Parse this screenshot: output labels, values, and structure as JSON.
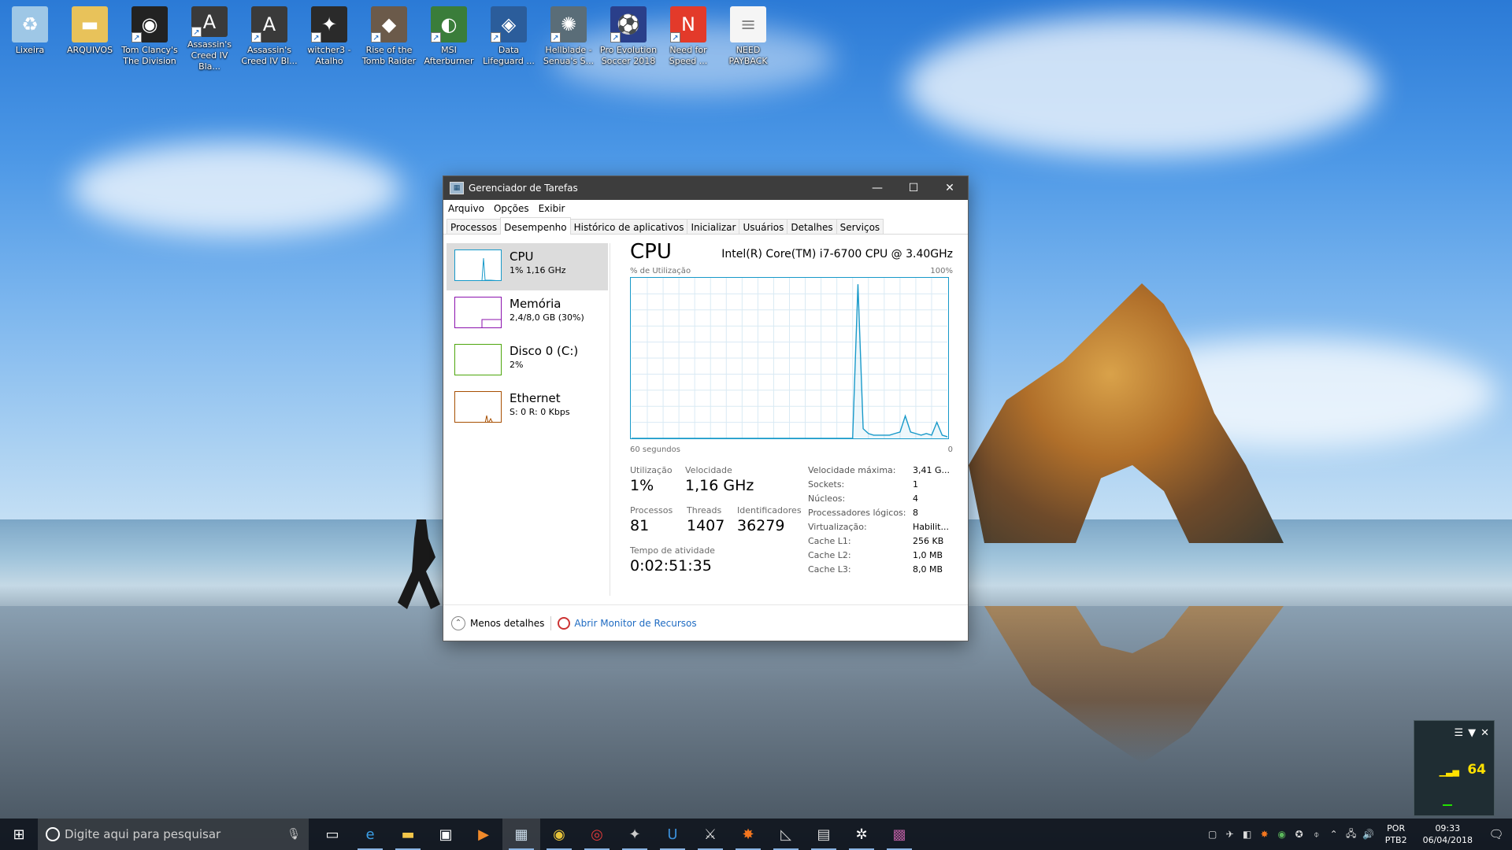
{
  "desktop": {
    "icons": [
      {
        "label": "Lixeira",
        "icon": "recycle-bin-icon",
        "glyph": "♻",
        "bg": "#9ec7e6",
        "shortcut": false
      },
      {
        "label": "ARQUIVOS",
        "icon": "folder-icon",
        "glyph": "▬",
        "bg": "#e8c25a",
        "shortcut": false
      },
      {
        "label": "Tom Clancy's The Division",
        "icon": "division-game-icon",
        "glyph": "◉",
        "bg": "#222",
        "shortcut": true
      },
      {
        "label": "Assassin's Creed IV Bla...",
        "icon": "assassins-creed-icon",
        "glyph": "A",
        "bg": "#3a3a3a",
        "shortcut": true
      },
      {
        "label": "Assassin's Creed IV Bl...",
        "icon": "assassins-creed-icon",
        "glyph": "A",
        "bg": "#3a3a3a",
        "shortcut": true
      },
      {
        "label": "witcher3 - Atalho",
        "icon": "witcher-icon",
        "glyph": "✦",
        "bg": "#2a2a2a",
        "shortcut": true
      },
      {
        "label": "Rise of the Tomb Raider",
        "icon": "tomb-raider-icon",
        "glyph": "◆",
        "bg": "#6b5a4a",
        "shortcut": true
      },
      {
        "label": "MSI Afterburner",
        "icon": "msi-afterburner-icon",
        "glyph": "◐",
        "bg": "#3a7d3a",
        "shortcut": true
      },
      {
        "label": "Data Lifeguard ...",
        "icon": "data-lifeguard-icon",
        "glyph": "◈",
        "bg": "#2b5d9b",
        "shortcut": true
      },
      {
        "label": "Hellblade - Senua's S...",
        "icon": "hellblade-icon",
        "glyph": "✺",
        "bg": "#5a6d78",
        "shortcut": true
      },
      {
        "label": "Pro Evolution Soccer 2018",
        "icon": "pes-icon",
        "glyph": "⚽",
        "bg": "#2a3f8a",
        "shortcut": true
      },
      {
        "label": "Need for Speed ...",
        "icon": "nfs-icon",
        "glyph": "N",
        "bg": "#e33a2a",
        "shortcut": true
      },
      {
        "label": "NEED PAYBACK",
        "icon": "text-file-icon",
        "glyph": "≡",
        "bg": "#f5f5f5",
        "shortcut": false
      }
    ]
  },
  "taskmgr": {
    "title": "Gerenciador de Tarefas",
    "menu": [
      "Arquivo",
      "Opções",
      "Exibir"
    ],
    "tabs": [
      "Processos",
      "Desempenho",
      "Histórico de aplicativos",
      "Inicializar",
      "Usuários",
      "Detalhes",
      "Serviços"
    ],
    "active_tab": "Desempenho",
    "sidebar": [
      {
        "name": "CPU",
        "value": "1% 1,16 GHz",
        "color": "#1799c9",
        "selected": true
      },
      {
        "name": "Memória",
        "value": "2,4/8,0 GB (30%)",
        "color": "#8b12ae",
        "selected": false
      },
      {
        "name": "Disco 0 (C:)",
        "value": "2%",
        "color": "#4da60c",
        "selected": false
      },
      {
        "name": "Ethernet",
        "value": "S: 0 R: 0 Kbps",
        "color": "#a74f01",
        "selected": false
      }
    ],
    "main": {
      "heading": "CPU",
      "model": "Intel(R) Core(TM) i7-6700 CPU @ 3.40GHz",
      "graph_label_left": "% de Utilização",
      "graph_label_right": "100%",
      "axis_left": "60 segundos",
      "axis_right": "0",
      "stats": {
        "utilizacao_label": "Utilização",
        "utilizacao": "1%",
        "velocidade_label": "Velocidade",
        "velocidade": "1,16 GHz",
        "processos_label": "Processos",
        "processos": "81",
        "threads_label": "Threads",
        "threads": "1407",
        "identificadores_label": "Identificadores",
        "identificadores": "36279",
        "tempo_label": "Tempo de atividade",
        "tempo": "0:02:51:35"
      },
      "specs": [
        {
          "k": "Velocidade máxima:",
          "v": "3,41 G..."
        },
        {
          "k": "Sockets:",
          "v": "1"
        },
        {
          "k": "Núcleos:",
          "v": "4"
        },
        {
          "k": "Processadores lógicos:",
          "v": "8"
        },
        {
          "k": "Virtualização:",
          "v": "Habilit..."
        },
        {
          "k": "Cache L1:",
          "v": "256 KB"
        },
        {
          "k": "Cache L2:",
          "v": "1,0 MB"
        },
        {
          "k": "Cache L3:",
          "v": "8,0 MB"
        }
      ]
    },
    "footer": {
      "less": "Menos detalhes",
      "resmon": "Abrir Monitor de Recursos"
    }
  },
  "chart_data": {
    "type": "line",
    "title": "CPU",
    "xlabel": "",
    "ylabel": "% de Utilização",
    "x": [
      60,
      57,
      54,
      51,
      48,
      45,
      42,
      39,
      36,
      33,
      30,
      27,
      24,
      21,
      18,
      17,
      16,
      15,
      14,
      13,
      12,
      11,
      10,
      9,
      8,
      7,
      6,
      5,
      4,
      3,
      2,
      1,
      0
    ],
    "values": [
      0,
      0,
      0,
      0,
      0,
      0,
      0,
      0,
      0,
      0,
      0,
      0,
      0,
      0,
      0,
      96,
      6,
      3,
      2,
      2,
      2,
      2,
      3,
      4,
      14,
      4,
      3,
      2,
      3,
      2,
      10,
      2,
      1
    ],
    "xlim": [
      60,
      0
    ],
    "ylim": [
      0,
      100
    ],
    "grid": true,
    "line_color": "#1799c9"
  },
  "widget": {
    "value": "64"
  },
  "taskbar": {
    "search_placeholder": "Digite aqui para pesquisar",
    "apps": [
      {
        "icon": "task-view-icon",
        "glyph": "▭",
        "color": "#fff"
      },
      {
        "icon": "edge-icon",
        "glyph": "e",
        "color": "#3ba0e8"
      },
      {
        "icon": "file-explorer-icon",
        "glyph": "▬",
        "color": "#f3c64a"
      },
      {
        "icon": "store-icon",
        "glyph": "▣",
        "color": "#fff"
      },
      {
        "icon": "media-player-icon",
        "glyph": "▶",
        "color": "#f18a2a"
      },
      {
        "icon": "task-manager-icon",
        "glyph": "▦",
        "color": "#cfe0ee"
      },
      {
        "icon": "chrome-icon",
        "glyph": "◉",
        "color": "#e7c33a"
      },
      {
        "icon": "game-launcher-icon",
        "glyph": "◎",
        "color": "#e03a3a"
      },
      {
        "icon": "witcher-icon",
        "glyph": "✦",
        "color": "#ccc"
      },
      {
        "icon": "uplay-icon",
        "glyph": "U",
        "color": "#3b8fd9"
      },
      {
        "icon": "gaming-app-icon",
        "glyph": "⚔",
        "color": "#ddd"
      },
      {
        "icon": "avast-icon",
        "glyph": "✸",
        "color": "#f3761f"
      },
      {
        "icon": "afterburner-icon",
        "glyph": "◺",
        "color": "#ccc"
      },
      {
        "icon": "benchmark-icon",
        "glyph": "▤",
        "color": "#ddd"
      },
      {
        "icon": "video-editor-icon",
        "glyph": "✲",
        "color": "#fff"
      },
      {
        "icon": "game-icon",
        "glyph": "▩",
        "color": "#b05a9a"
      }
    ],
    "tray": {
      "lang_top": "POR",
      "lang_bottom": "PTB2",
      "time": "09:33",
      "date": "06/04/2018"
    }
  }
}
